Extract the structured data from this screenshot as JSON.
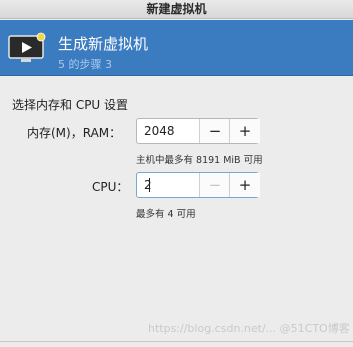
{
  "window": {
    "title": "新建虚拟机"
  },
  "banner": {
    "title": "生成新虚拟机",
    "step": "5 的步骤 3",
    "icon": "monitor-icon"
  },
  "section_title": "选择内存和 CPU 设置",
  "memory": {
    "label": "内存(M)，RAM：",
    "value": "2048",
    "minus": "−",
    "plus": "+",
    "hint": "主机中最多有 8191 MiB 可用"
  },
  "cpu": {
    "label": "CPU：",
    "value": "2",
    "minus": "−",
    "plus": "+",
    "hint": "最多有 4 可用"
  },
  "watermark": "https://blog.csdn.net/... @51CTO博客"
}
